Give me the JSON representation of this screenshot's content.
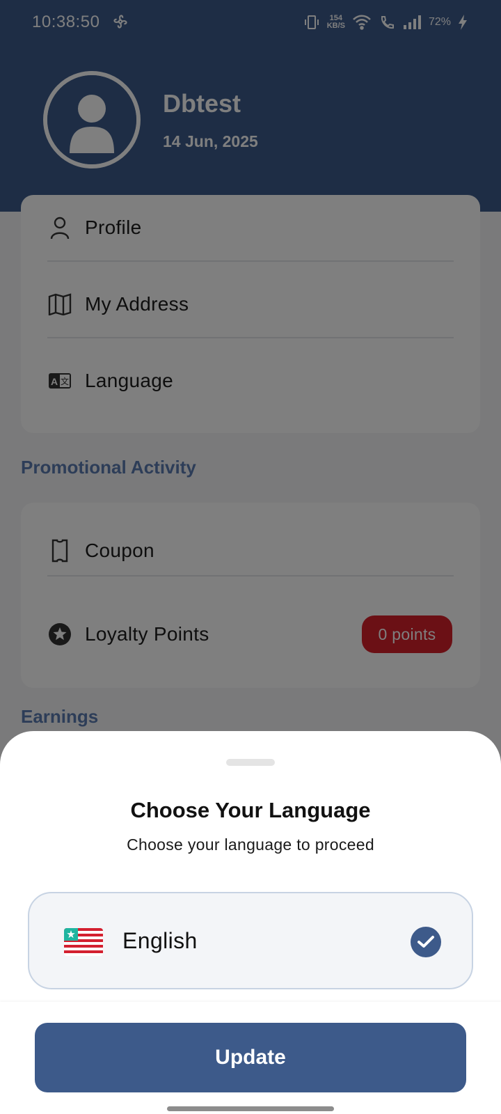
{
  "status_bar": {
    "time": "10:38:50",
    "net_speed_value": "154",
    "net_speed_unit": "KB/S",
    "battery": "72%"
  },
  "header": {
    "user_name": "Dbtest",
    "date": "14 Jun, 2025",
    "avatar_icon": "user-avatar-icon",
    "background_color": "#3d5a8a"
  },
  "account_menu": {
    "items": [
      {
        "label": "Profile",
        "icon": "person-icon"
      },
      {
        "label": "My Address",
        "icon": "map-icon"
      },
      {
        "label": "Language",
        "icon": "translate-icon"
      }
    ]
  },
  "promotional": {
    "section_title": "Promotional Activity",
    "items": [
      {
        "label": "Coupon",
        "icon": "ticket-icon"
      },
      {
        "label": "Loyalty Points",
        "icon": "star-circle-icon",
        "badge": "0 points"
      }
    ]
  },
  "earnings": {
    "section_title": "Earnings"
  },
  "language_sheet": {
    "title": "Choose Your Language",
    "subtitle": "Choose your language to proceed",
    "options": [
      {
        "label": "English",
        "flag": "liberia-flag-icon",
        "selected": true
      }
    ],
    "update_label": "Update",
    "accent_color": "#3d5a8a"
  }
}
